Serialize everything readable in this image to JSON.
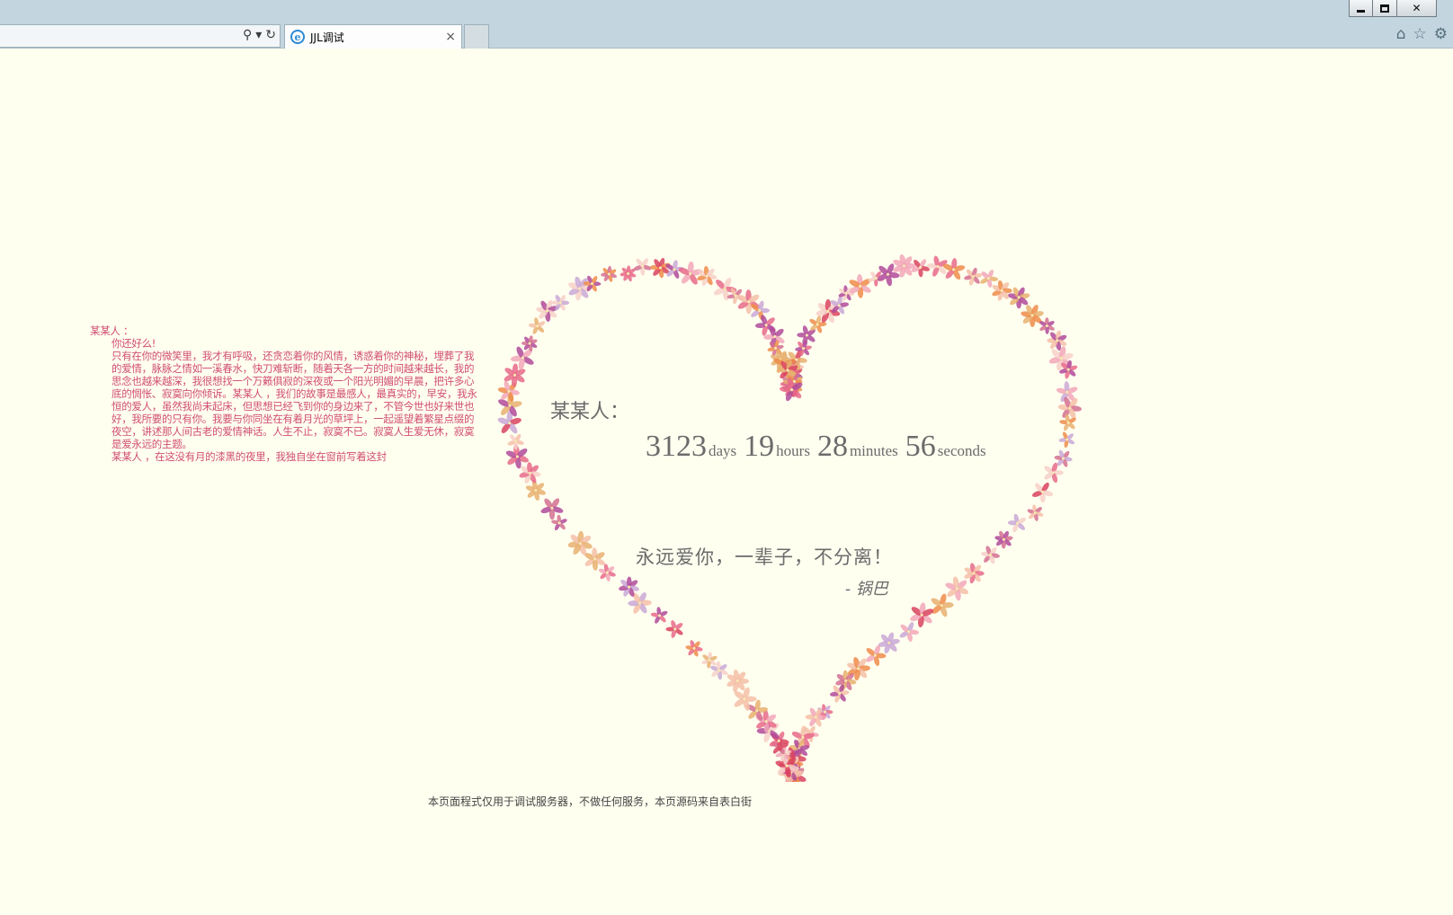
{
  "window": {
    "minimize_icon": "minimize-icon",
    "restore_icon": "restore-icon",
    "close_glyph": "✕"
  },
  "browser": {
    "tab_title": "JJL调试",
    "tab_close_glyph": "×",
    "search_glyph": "⚲",
    "dropdown_glyph": "▾",
    "refresh_glyph": "↻",
    "home_glyph": "⌂",
    "favorites_glyph": "☆",
    "tools_glyph": "⚙"
  },
  "letter": {
    "salutation": "某某人 ：",
    "greeting": "你还好么!",
    "body": "只有在你的微笑里，我才有呼吸，还贪恋着你的风情，诱惑着你的神秘，埋葬了我的爱情，脉脉之情如一溪春水，快刀难斩断，随着天各一方的时间越来越长，我的思念也越来越深，我很想找一个万籁俱寂的深夜或一个阳光明媚的早晨，把许多心底的惆怅、寂寞向你倾诉。某某人 ，我们的故事是最感人，最真实的，早安，我永恒的爱人，虽然我尚未起床，但思想已经飞到你的身边来了，不管今世也好来世也好，我所要的只有你。我要与你同坐在有着月光的草坪上，一起遥望着繁星点缀的夜空，讲述那人间古老的爱情神话。人生不止，寂寞不已。寂寞人生爱无休，寂寞是爱永远的主题。",
    "closing": "某某人 ，在这没有月的漆黑的夜里，我独自坐在窗前写着这封"
  },
  "heart": {
    "to_name": "某某人：",
    "days": "3123",
    "days_label": "days",
    "hours": "19",
    "hours_label": "hours",
    "minutes": "28",
    "minutes_label": "minutes",
    "seconds": "56",
    "seconds_label": "seconds",
    "message": "永远爱你，一辈子，不分离！",
    "signature": "- 锅巴",
    "flower_colors": [
      "#f2a7b8",
      "#e86a8a",
      "#d9435f",
      "#f5c0a8",
      "#ef8c4a",
      "#c9a8d6",
      "#b04a9a",
      "#f7d0c8",
      "#e8b070",
      "#d47090"
    ]
  },
  "footer": {
    "note": "本页面程式仅用于调试服务器，不做任何服务，本页源码来自表白街"
  }
}
